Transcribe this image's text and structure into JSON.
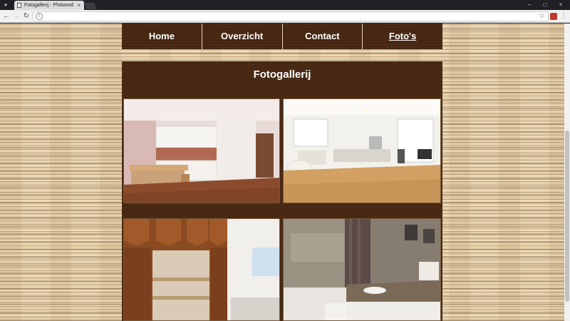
{
  "browser": {
    "tab_title": "Fotogallerij - Phiiwood",
    "window_controls": [
      "–",
      "□",
      "×"
    ]
  },
  "nav": {
    "items": [
      {
        "label": "Home",
        "active": false
      },
      {
        "label": "Overzicht",
        "active": false
      },
      {
        "label": "Contact",
        "active": false
      },
      {
        "label": "Foto's",
        "active": true
      }
    ]
  },
  "gallery": {
    "title": "Fotogallerij",
    "photos": [
      {
        "subject": "kitchen-pink-walls"
      },
      {
        "subject": "white-kitchen-open-plan"
      },
      {
        "subject": "walnut-cabinet-closet"
      },
      {
        "subject": "bathroom-granite-vanity"
      }
    ]
  },
  "colors": {
    "nav_bg": "#4a2a14",
    "page_bg": "#e6d1ad",
    "text": "#ffffff"
  }
}
